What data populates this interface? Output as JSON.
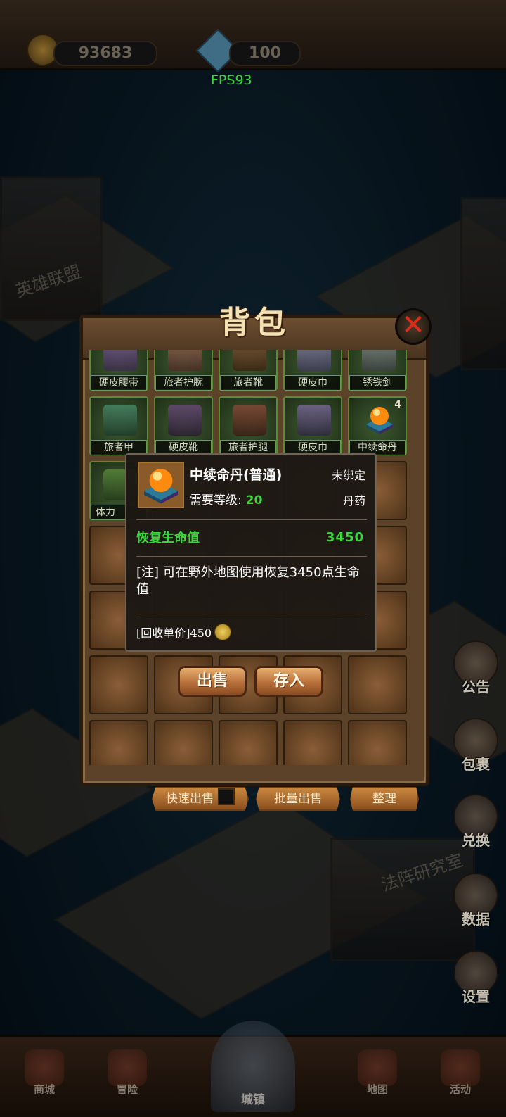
{
  "top_bar": {
    "coins": "93683",
    "gems": "100",
    "fps": "FPS93"
  },
  "map": {
    "building_1": "英雄联盟",
    "building_2": "法阵研究室"
  },
  "bag": {
    "title": "背包",
    "close_icon": "close-x-icon",
    "slots_row_1": [
      {
        "label": "硬皮腰带"
      },
      {
        "label": "旅者护腕"
      },
      {
        "label": "旅者靴"
      },
      {
        "label": "硬皮巾"
      },
      {
        "label": "锈铁剑"
      }
    ],
    "slots_row_2": [
      {
        "label": "旅者甲"
      },
      {
        "label": "硬皮靴"
      },
      {
        "label": "旅者护腿"
      },
      {
        "label": "硬皮巾"
      },
      {
        "label": "中续命丹",
        "count": "4"
      }
    ],
    "slot_row_3_first_label": "体力"
  },
  "tooltip": {
    "name": "中续命丹(普通)",
    "bind_status": "未绑定",
    "level_label": "需要等级:",
    "level_value": "20",
    "item_type": "丹药",
    "attr_name": "恢复生命值",
    "attr_value": "3450",
    "description": "[注] 可在野外地图使用恢复3450点生命值",
    "price_label": "[回收单价]450",
    "price_icon": "gold-coin-icon",
    "sell_button": "出售",
    "store_button": "存入"
  },
  "bag_actions": {
    "quick_sell": "快速出售",
    "batch_sell": "批量出售",
    "sort": "整理"
  },
  "side_menu": {
    "announcement": "公告",
    "gift_pack": "包裹",
    "exchange": "兑换",
    "data": "数据",
    "settings": "设置"
  },
  "bottom_nav": {
    "shop": "商城",
    "adventure": "冒险",
    "city": "城镇",
    "map": "地图",
    "events": "活动"
  },
  "colors": {
    "accent_green": "#3ad83a",
    "panel_brown": "#5c4228",
    "button_orange": "#b8703a"
  }
}
